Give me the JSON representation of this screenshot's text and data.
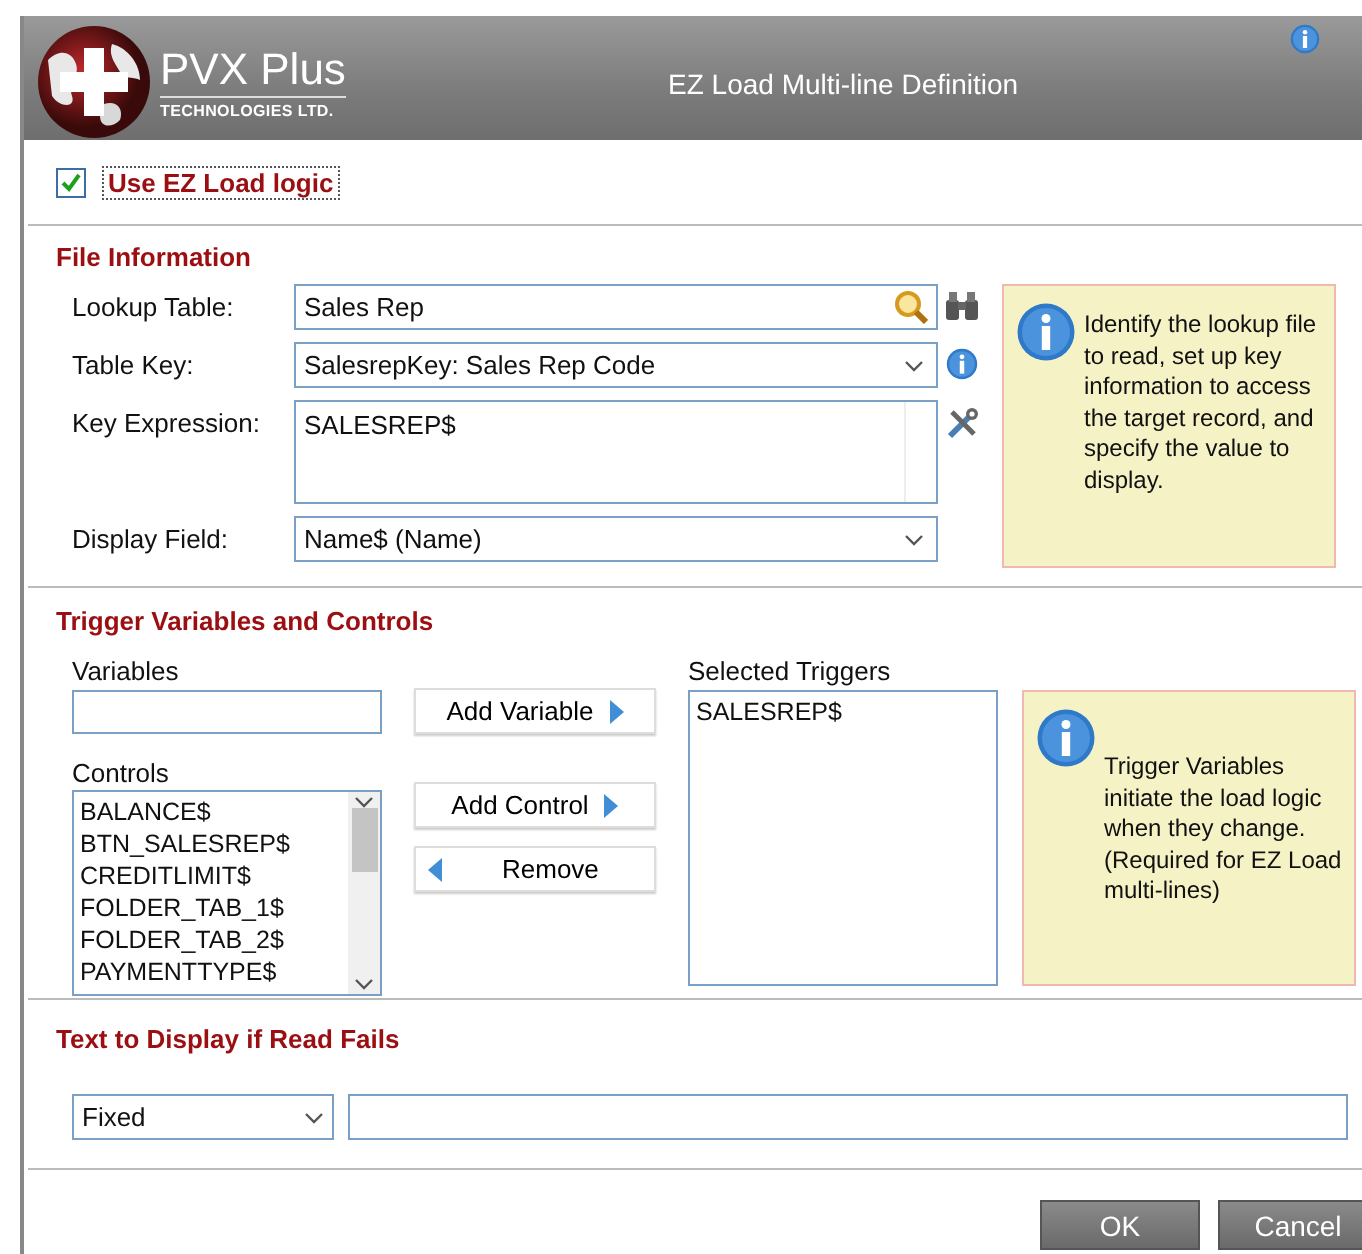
{
  "window": {
    "title": "EZ Load Multi-line Definition",
    "logo_name": "PVX Plus",
    "logo_subtitle": "TECHNOLOGIES LTD."
  },
  "use_ez_load": {
    "label": "Use EZ Load logic",
    "checked": true
  },
  "file_information": {
    "heading": "File Information",
    "fields": [
      {
        "label": "Lookup Table:",
        "value": "Sales Rep",
        "kind": "lookup"
      },
      {
        "label": "Table Key:",
        "value": "SalesrepKey: Sales Rep Code",
        "kind": "keyed-dropdown"
      },
      {
        "label": "Key Expression:",
        "value": "SALESREP$",
        "kind": "expression"
      },
      {
        "label": "Display Field:",
        "value": "Name$ (Name)",
        "kind": "dropdown"
      }
    ],
    "info": "Identify the lookup file to read, set up key information to access the target record, and specify the value to display."
  },
  "triggers": {
    "heading": "Trigger Variables and Controls",
    "variables_label": "Variables",
    "controls_label": "Controls",
    "controls": [
      "BALANCE$",
      "BTN_SALESREP$",
      "CREDITLIMIT$",
      "FOLDER_TAB_1$",
      "FOLDER_TAB_2$",
      "PAYMENTTYPE$"
    ],
    "actions": [
      {
        "label": "Add Variable",
        "kind": "add"
      },
      {
        "label": "Add Control",
        "kind": "add"
      },
      {
        "label": "Remove",
        "kind": "remove"
      }
    ],
    "selected_label": "Selected Triggers",
    "selected": [
      "SALESREP$"
    ],
    "info": "Trigger Variables initiate the load logic when they change.\n(Required for EZ Load multi-lines)"
  },
  "read_fails": {
    "heading": "Text to Display if Read Fails",
    "mode": "Fixed"
  },
  "buttons": [
    {
      "label": "OK"
    },
    {
      "label": "Cancel"
    }
  ]
}
